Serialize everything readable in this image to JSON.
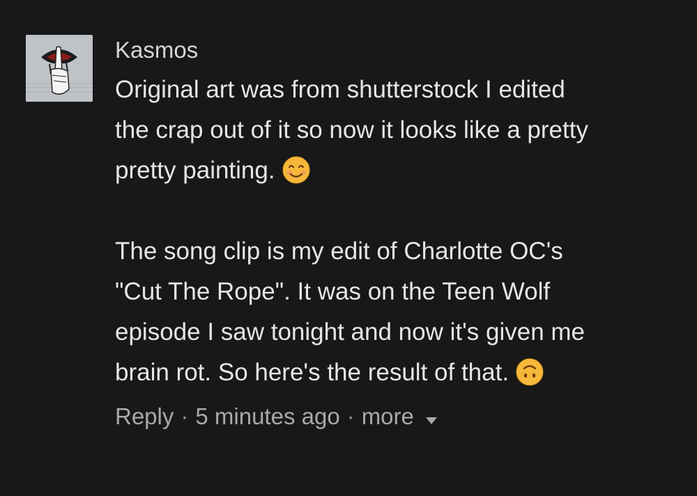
{
  "comment": {
    "author": "Kasmos",
    "paragraph1_lines": [
      "Original art was from shutterstock I edited",
      "the crap out of it so now it looks like a pretty",
      "pretty painting."
    ],
    "paragraph2_lines": [
      "The song clip is my edit of Charlotte OC's",
      "\"Cut The Rope\". It was on the Teen Wolf",
      "episode I saw tonight and now it's given me",
      "brain rot. So here's the result of that."
    ],
    "emoji1": "smiling-face-icon",
    "emoji2": "upside-down-face-icon"
  },
  "actions": {
    "reply_label": "Reply",
    "separator": "·",
    "time_label": "5 minutes ago",
    "more_label": "more"
  },
  "colors": {
    "background": "#181818",
    "text": "#e6e6e6",
    "meta": "#a9a9a9",
    "emoji": "#f6b83a"
  }
}
